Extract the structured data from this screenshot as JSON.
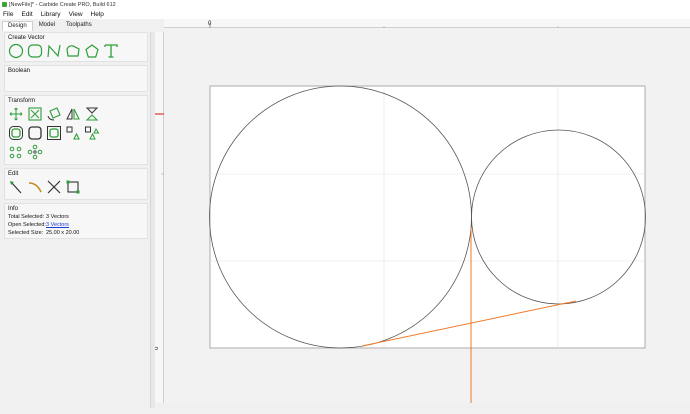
{
  "window": {
    "title": "[NewFile]* - Carbide Create PRO, Build 612"
  },
  "menu": {
    "file": "File",
    "edit": "Edit",
    "library": "Library",
    "view": "View",
    "help": "Help"
  },
  "tabs": {
    "design": "Design",
    "model": "Model",
    "toolpaths": "Toolpaths"
  },
  "create_vector": {
    "title": "Create Vector",
    "icons": [
      "circle-tool-icon",
      "ellipse-tool-icon",
      "curve-tool-icon",
      "polygon-tool-icon",
      "pentagon-tool-icon",
      "text-tool-icon"
    ]
  },
  "boolean": {
    "title": "Boolean"
  },
  "transform": {
    "title": "Transform",
    "icons": [
      "move-icon",
      "scale-icon",
      "rotate-icon",
      "mirror-icon",
      "flip-icon",
      "offset-icon",
      "fillet-icon",
      "inset-icon",
      "align-icon",
      "distribute-icon",
      "linear-array-icon",
      "circular-array-icon"
    ]
  },
  "edit": {
    "title": "Edit",
    "icons": [
      "node-edit-icon",
      "smooth-icon",
      "trim-icon",
      "bounding-box-icon"
    ]
  },
  "info": {
    "title": "Info",
    "total_selected_label": "Total Selected:",
    "total_selected_value": "3 Vectors",
    "open_selected_label": "Open Selected:",
    "open_selected_value": "3 Vectors",
    "selected_size_label": "Selected Size:",
    "selected_size_value": "25.00 x 20.00"
  },
  "rulers": {
    "h_origin": "0",
    "v_origin": "0"
  },
  "colors": {
    "accent_green": "#2e9e3a",
    "selection_orange": "#f07a2a",
    "origin_red": "#d93a2b"
  }
}
